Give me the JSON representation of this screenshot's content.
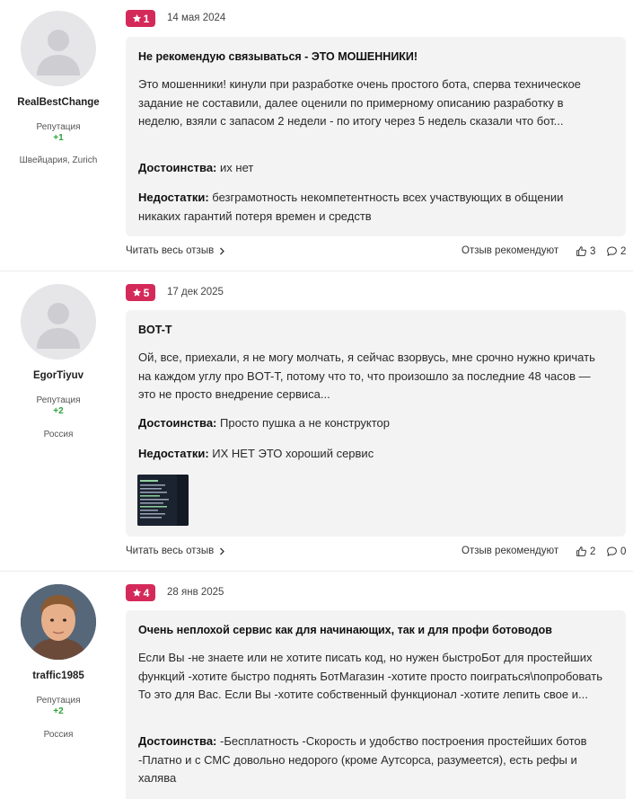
{
  "reviews": [
    {
      "author": {
        "name": "RealBestChange",
        "reputation_label": "Репутация",
        "reputation_value": "+1",
        "location": "Швейцария, Zurich"
      },
      "rating": "1",
      "date": "14 мая 2024",
      "title": "Не рекомендую связываться - ЭТО МОШЕННИКИ!",
      "body": "Это мошенники! кинули при разработке очень простого бота, сперва техническое задание не составили, далее оценили по примерному описанию разработку в неделю, взяли с запасом 2 недели - по итогу через 5 недель сказали что бот...",
      "pros_label": "Достоинства:",
      "pros": "их нет",
      "cons_label": "Недостатки:",
      "cons": "безграмотность некомпетентность всех участвующих в общении никаких гарантий потеря времен и средств",
      "read_more": "Читать весь отзыв",
      "recommend_label": "Отзыв рекомендуют",
      "likes": "3",
      "comments": "2"
    },
    {
      "author": {
        "name": "EgorTiyuv",
        "reputation_label": "Репутация",
        "reputation_value": "+2",
        "location": "Россия"
      },
      "rating": "5",
      "date": "17 дек 2025",
      "title": "BOT-T",
      "body": "Ой, все, приехали, я не могу молчать, я сейчас взорвусь, мне срочно нужно кричать на каждом углу про BOT-T, потому что то, что произошло за последние 48 часов — это не просто внедрение сервиса...",
      "pros_label": "Достоинства:",
      "pros": "Просто пушка а не конструктор",
      "cons_label": "Недостатки:",
      "cons": "ИХ НЕТ ЭТО хороший сервис",
      "read_more": "Читать весь отзыв",
      "recommend_label": "Отзыв рекомендуют",
      "likes": "2",
      "comments": "0"
    },
    {
      "author": {
        "name": "traffic1985",
        "reputation_label": "Репутация",
        "reputation_value": "+2",
        "location": "Россия"
      },
      "rating": "4",
      "date": "28 янв 2025",
      "title": "Очень неплохой сервис как для начинающих, так и для профи ботоводов",
      "body": "Если Вы -не знаете или не хотите писать код, но нужен быстроБот для простейших функций -хотите быстро поднять БотМагазин -хотите просто поиграться\\попробовать То это для Вас. Если Вы -хотите собственный функционал -хотите лепить свое и...",
      "pros_label": "Достоинства:",
      "pros": "-Бесплатность -Скорость и удобство построения простейших ботов -Платно и с СМС довольно недорого (кроме Аутсорса, разумеется), есть рефы и халява"
    }
  ],
  "colors": {
    "badge": "#d42a5a",
    "reputation": "#2aa339",
    "card": "#f3f3f4"
  },
  "icons": {
    "star": "star-icon",
    "chevron": "chevron-right-icon",
    "like": "thumbs-up-icon",
    "comment": "comment-icon"
  }
}
